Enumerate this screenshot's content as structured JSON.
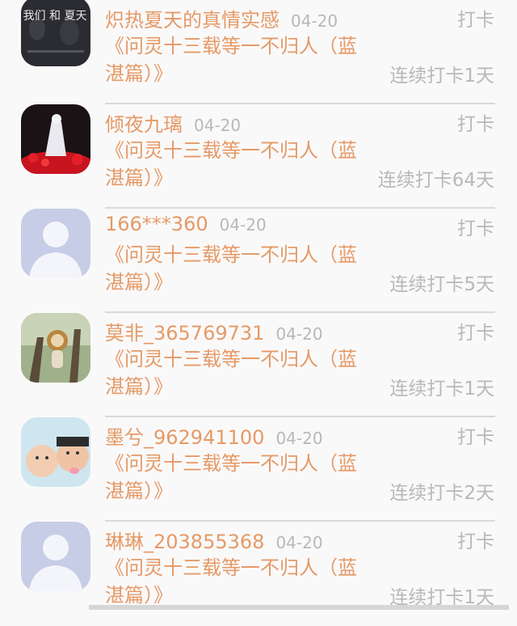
{
  "checkins": [
    {
      "name": "炽热夏天的真情实感",
      "date": "04-20",
      "book": "《问灵十三载等一不归人（蓝湛篇）》",
      "action": "打卡",
      "streak": "连续打卡1天",
      "avatar_text": "我们 和 夏天",
      "avatar": "dark-poster-avatar"
    },
    {
      "name": "倾夜九璃",
      "date": "04-20",
      "book": "《问灵十三载等一不归人（蓝湛篇）》",
      "action": "打卡",
      "streak": "连续打卡64天",
      "avatar": "red-flowers-avatar"
    },
    {
      "name": "166***360",
      "date": "04-20",
      "book": "《问灵十三载等一不归人（蓝湛篇）》",
      "action": "打卡",
      "streak": "连续打卡5天",
      "avatar": "default-user-avatar"
    },
    {
      "name": "莫非_365769731",
      "date": "04-20",
      "book": "《问灵十三载等一不归人（蓝湛篇）》",
      "action": "打卡",
      "streak": "连续打卡1天",
      "avatar": "tree-lion-avatar"
    },
    {
      "name": "墨兮_962941100",
      "date": "04-20",
      "book": "《问灵十三载等一不归人（蓝湛篇）》",
      "action": "打卡",
      "streak": "连续打卡2天",
      "avatar": "children-photo-avatar"
    },
    {
      "name": "琳琳_203855368",
      "date": "04-20",
      "book": "《问灵十三载等一不归人（蓝湛篇）》",
      "action": "打卡",
      "streak": "连续打卡1天",
      "avatar": "default-user-avatar"
    }
  ],
  "colors": {
    "accent": "#e59a66",
    "muted": "#b8b8b8",
    "divider": "#d9d9d9",
    "avatar_default_bg": "#c7cde6"
  }
}
